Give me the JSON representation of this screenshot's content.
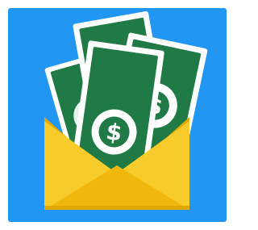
{
  "icon": {
    "name": "money-envelope-icon",
    "background_color": "#2196F3",
    "bill_color": "#1F7A46",
    "bill_paper_color": "#FFFFFF",
    "envelope_color": "#F5C518",
    "envelope_shade_color": "#E0A800",
    "symbol": "$"
  }
}
